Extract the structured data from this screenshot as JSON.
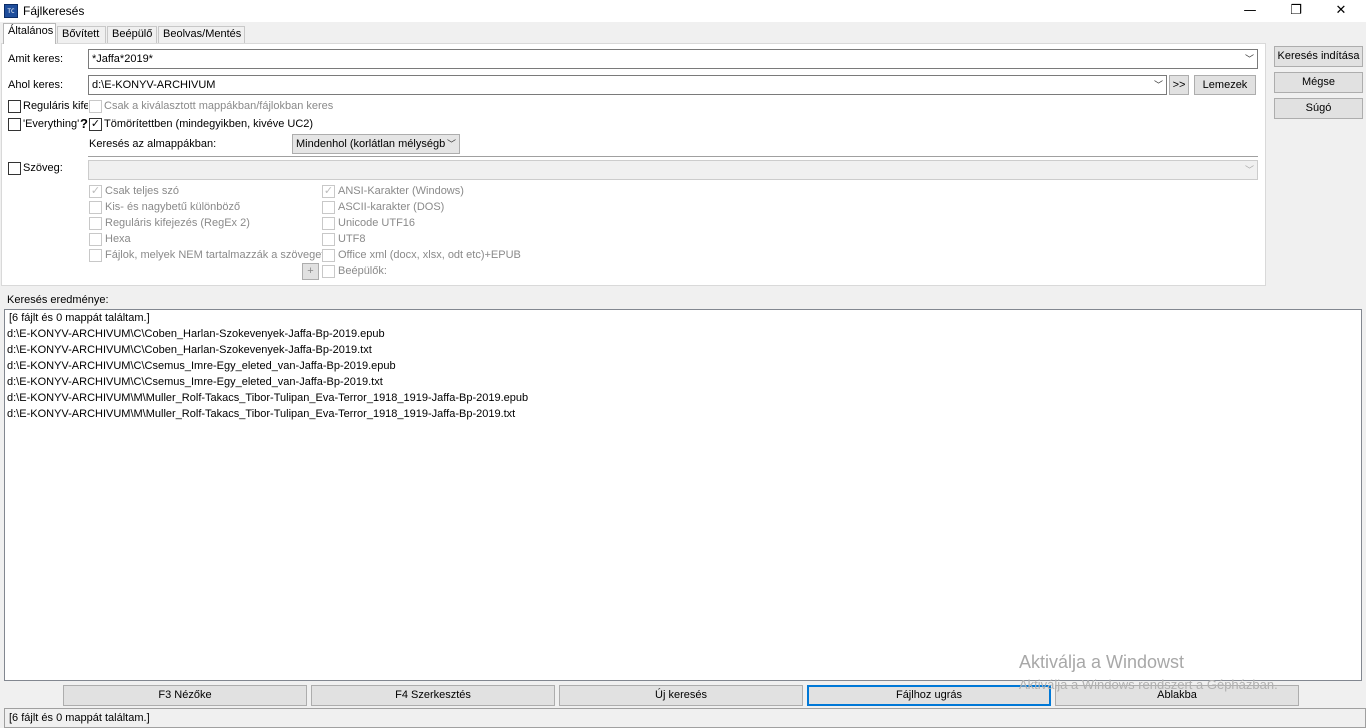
{
  "window": {
    "title": "Fájlkeresés",
    "icon_text": "TC",
    "minimize": "—",
    "maximize": "❐",
    "close": "✕"
  },
  "tabs": [
    {
      "label": "Általános",
      "active": true
    },
    {
      "label": "Bővített"
    },
    {
      "label": "Beépülő"
    },
    {
      "label": "Beolvas/Mentés"
    }
  ],
  "general": {
    "search_for_label": "Amit keres:",
    "search_for_value": "*Jaffa*2019*",
    "search_in_label": "Ahol keres:",
    "search_in_value": "d:\\E-KONYV-ARCHIVUM",
    "browse_button": ">>",
    "drives_button": "Lemezek",
    "regex_label": "Reguláris kife",
    "only_selected_label": "Csak a kiválasztott mappákban/fájlokban keres",
    "everything_label": "'Everything'",
    "everything_help": "?",
    "archives_label": "Tömörítettben (mindegyikben, kivéve UC2)",
    "subdir_label": "Keresés az almappákban:",
    "subdir_value": "Mindenhol (korlátlan mélységbe",
    "text_label": "Szöveg:",
    "text_value": "",
    "options_left": [
      {
        "label": "Csak teljes szó",
        "checked": true
      },
      {
        "label": "Kis- és nagybetű különböző",
        "checked": false
      },
      {
        "label": "Reguláris kifejezés (RegEx 2)",
        "checked": false
      },
      {
        "label": "Hexa",
        "checked": false
      },
      {
        "label": "Fájlok, melyek NEM tartalmazzák a szöveget",
        "checked": false
      }
    ],
    "options_right": [
      {
        "label": "ANSI-Karakter (Windows)",
        "checked": true
      },
      {
        "label": "ASCII-karakter (DOS)",
        "checked": false
      },
      {
        "label": "Unicode UTF16",
        "checked": false
      },
      {
        "label": "UTF8",
        "checked": false
      },
      {
        "label": "Office xml (docx, xlsx, odt etc)+EPUB",
        "checked": false
      },
      {
        "label": "Beépülők:",
        "checked": false
      }
    ],
    "plus_button": "+"
  },
  "side_buttons": {
    "start": "Keresés indítása",
    "cancel": "Mégse",
    "help": "Súgó"
  },
  "results": {
    "label": "Keresés eredménye:",
    "rows": [
      "[6 fájlt és 0 mappát találtam.]",
      "d:\\E-KONYV-ARCHIVUM\\C\\Coben_Harlan-Szokevenyek-Jaffa-Bp-2019.epub",
      "d:\\E-KONYV-ARCHIVUM\\C\\Coben_Harlan-Szokevenyek-Jaffa-Bp-2019.txt",
      "d:\\E-KONYV-ARCHIVUM\\C\\Csemus_Imre-Egy_eleted_van-Jaffa-Bp-2019.epub",
      "d:\\E-KONYV-ARCHIVUM\\C\\Csemus_Imre-Egy_eleted_van-Jaffa-Bp-2019.txt",
      "d:\\E-KONYV-ARCHIVUM\\M\\Muller_Rolf-Takacs_Tibor-Tulipan_Eva-Terror_1918_1919-Jaffa-Bp-2019.epub",
      "d:\\E-KONYV-ARCHIVUM\\M\\Muller_Rolf-Takacs_Tibor-Tulipan_Eva-Terror_1918_1919-Jaffa-Bp-2019.txt"
    ]
  },
  "bottom_buttons": {
    "view": "F3 Nézőke",
    "edit": "F4 Szerkesztés",
    "new_search": "Új keresés",
    "goto_file": "Fájlhoz ugrás",
    "feed_listbox": "Ablakba"
  },
  "status": "[6 fájlt és 0 mappát találtam.]",
  "watermark": {
    "line1": "Aktiválja a Windowst",
    "line2": "Aktiválja a Windows rendszert a Gépházban."
  }
}
